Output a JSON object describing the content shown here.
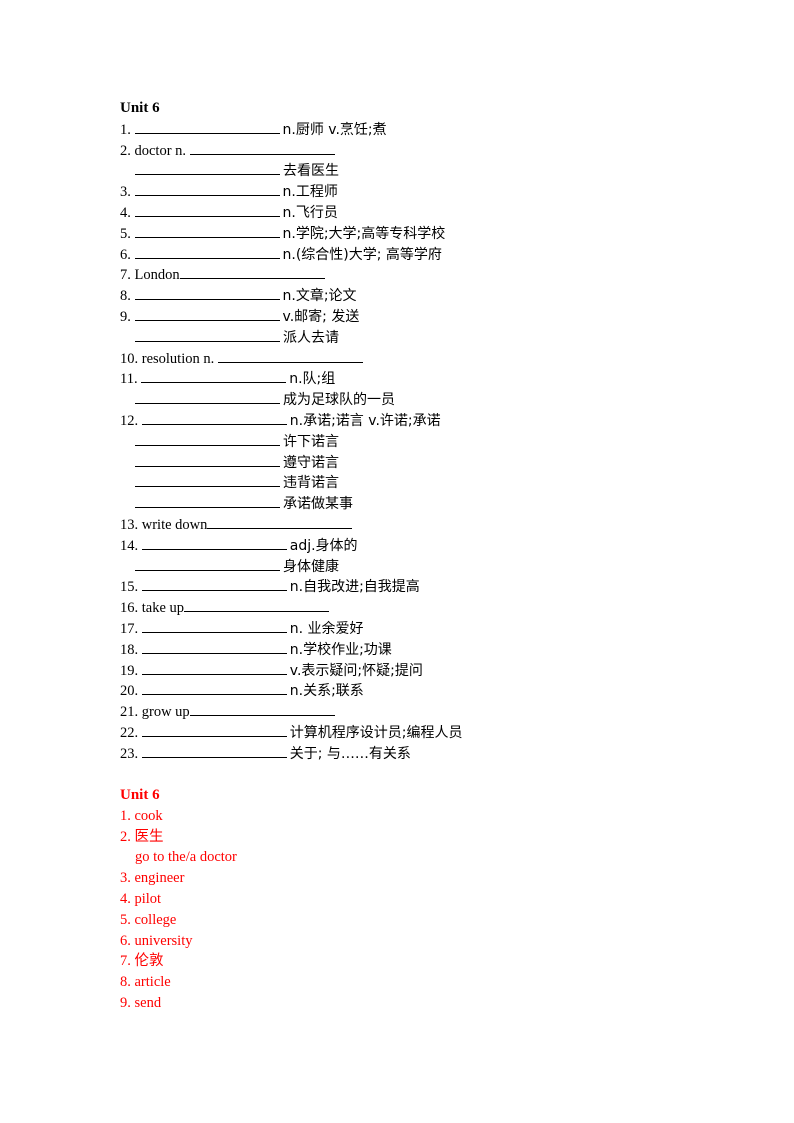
{
  "worksheet": {
    "title": "Unit 6",
    "items": [
      {
        "num": "1.",
        "prefix": "",
        "blank_first": true,
        "suffix": "n.厨师 v.烹饪;煮"
      },
      {
        "num": "2.",
        "prefix": "doctor n.",
        "blank_first": false,
        "suffix": ""
      },
      {
        "num": "",
        "prefix": "",
        "blank_first": true,
        "suffix": "去看医生",
        "indent": true
      },
      {
        "num": "3.",
        "prefix": "",
        "blank_first": true,
        "suffix": "n.工程师"
      },
      {
        "num": "4.",
        "prefix": "",
        "blank_first": true,
        "suffix": "n.飞行员"
      },
      {
        "num": "5.",
        "prefix": "",
        "blank_first": true,
        "suffix": "n.学院;大学;高等专科学校"
      },
      {
        "num": "6.",
        "prefix": "",
        "blank_first": true,
        "suffix": "n.(综合性)大学; 高等学府"
      },
      {
        "num": "7.",
        "prefix": "London",
        "blank_first": false,
        "suffix": ""
      },
      {
        "num": "8.",
        "prefix": "",
        "blank_first": true,
        "suffix": "n.文章;论文"
      },
      {
        "num": "9.",
        "prefix": "",
        "blank_first": true,
        "suffix": "v.邮寄; 发送"
      },
      {
        "num": "",
        "prefix": "",
        "blank_first": true,
        "suffix": "派人去请",
        "indent": true
      },
      {
        "num": "10.",
        "prefix": "resolution n.",
        "blank_first": false,
        "suffix": ""
      },
      {
        "num": "11.",
        "prefix": "",
        "blank_first": true,
        "suffix": "n.队;组"
      },
      {
        "num": "",
        "prefix": "",
        "blank_first": true,
        "suffix": "成为足球队的一员",
        "indent": true
      },
      {
        "num": "12.",
        "prefix": "",
        "blank_first": true,
        "suffix": "n.承诺;诺言 v.许诺;承诺"
      },
      {
        "num": "",
        "prefix": "",
        "blank_first": true,
        "suffix": "许下诺言",
        "indent": true
      },
      {
        "num": "",
        "prefix": "",
        "blank_first": true,
        "suffix": "遵守诺言",
        "indent": true
      },
      {
        "num": "",
        "prefix": "",
        "blank_first": true,
        "suffix": "违背诺言",
        "indent": true
      },
      {
        "num": "",
        "prefix": "",
        "blank_first": true,
        "suffix": "承诺做某事",
        "indent": true
      },
      {
        "num": "13.",
        "prefix": "write down",
        "blank_first": false,
        "suffix": ""
      },
      {
        "num": "14.",
        "prefix": "",
        "blank_first": true,
        "suffix": "adj.身体的"
      },
      {
        "num": "",
        "prefix": "",
        "blank_first": true,
        "suffix": "身体健康",
        "indent": true
      },
      {
        "num": "15.",
        "prefix": "",
        "blank_first": true,
        "suffix": "n.自我改进;自我提高"
      },
      {
        "num": "16.",
        "prefix": "take up",
        "blank_first": false,
        "suffix": ""
      },
      {
        "num": "17.",
        "prefix": "",
        "blank_first": true,
        "suffix": "n. 业余爱好"
      },
      {
        "num": "18.",
        "prefix": "",
        "blank_first": true,
        "suffix": "n.学校作业;功课"
      },
      {
        "num": "19.",
        "prefix": "",
        "blank_first": true,
        "suffix": "v.表示疑问;怀疑;提问"
      },
      {
        "num": "20.",
        "prefix": "",
        "blank_first": true,
        "suffix": "n.关系;联系"
      },
      {
        "num": "21.",
        "prefix": "grow up",
        "blank_first": false,
        "suffix": ""
      },
      {
        "num": "22.",
        "prefix": "",
        "blank_first": true,
        "suffix": "计算机程序设计员;编程人员"
      },
      {
        "num": "23.",
        "prefix": "",
        "blank_first": true,
        "suffix": "关于; 与……有关系"
      }
    ]
  },
  "answers": {
    "title": "Unit 6",
    "color": "#ff0000",
    "items": [
      {
        "text": "1. cook"
      },
      {
        "text": "2.  医生"
      },
      {
        "text": "go to the/a  doctor",
        "indent": true
      },
      {
        "text": "3. engineer"
      },
      {
        "text": "4. pilot"
      },
      {
        "text": "5. college"
      },
      {
        "text": "6. university"
      },
      {
        "text": "7.  伦敦"
      },
      {
        "text": "8. article"
      },
      {
        "text": "9. send"
      }
    ]
  }
}
